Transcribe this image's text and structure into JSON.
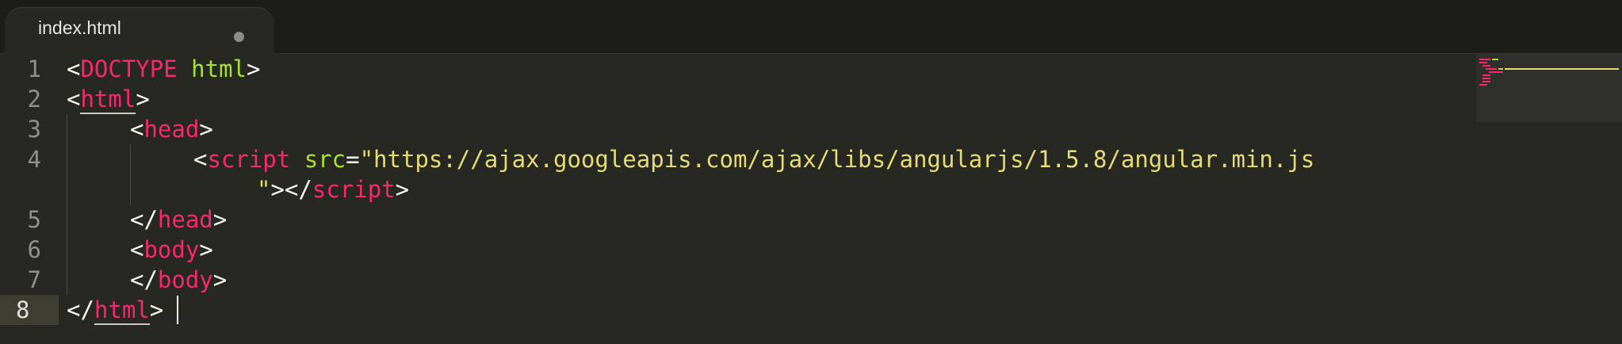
{
  "tab": {
    "filename": "index.html",
    "modified_indicator": "dirty-dot"
  },
  "editor": {
    "current_line": 8,
    "line_numbers": [
      "1",
      "2",
      "3",
      "4",
      "5",
      "6",
      "7",
      "8"
    ],
    "lines": {
      "l1": {
        "open": "<",
        "doctype": "DOCTYPE",
        "space": " ",
        "html": "html",
        "close": ">"
      },
      "l2": {
        "open": "<",
        "tag": "html",
        "close": ">"
      },
      "l3": {
        "open": "<",
        "tag": "head",
        "close": ">"
      },
      "l4": {
        "open": "<",
        "tag": "script",
        "space": " ",
        "attr": "src",
        "eq": "=",
        "value_part1": "\"https://ajax.googleapis.com/ajax/libs/angularjs/1.5.8/angular.min.js",
        "value_part2": "\"",
        "close_open": "></",
        "close_tag": "script",
        "close": ">"
      },
      "l5": {
        "open": "</",
        "tag": "head",
        "close": ">"
      },
      "l6": {
        "open": "<",
        "tag": "body",
        "close": ">"
      },
      "l7": {
        "open": "</",
        "tag": "body",
        "close": ">"
      },
      "l8": {
        "open": "</",
        "tag": "html",
        "close": ">"
      }
    }
  },
  "theme": {
    "background": "#272822",
    "tag_color": "#f92672",
    "attribute_color": "#a6e22e",
    "string_color": "#e6db74",
    "text_color": "#f8f8f2",
    "gutter_color": "#8f908a"
  }
}
